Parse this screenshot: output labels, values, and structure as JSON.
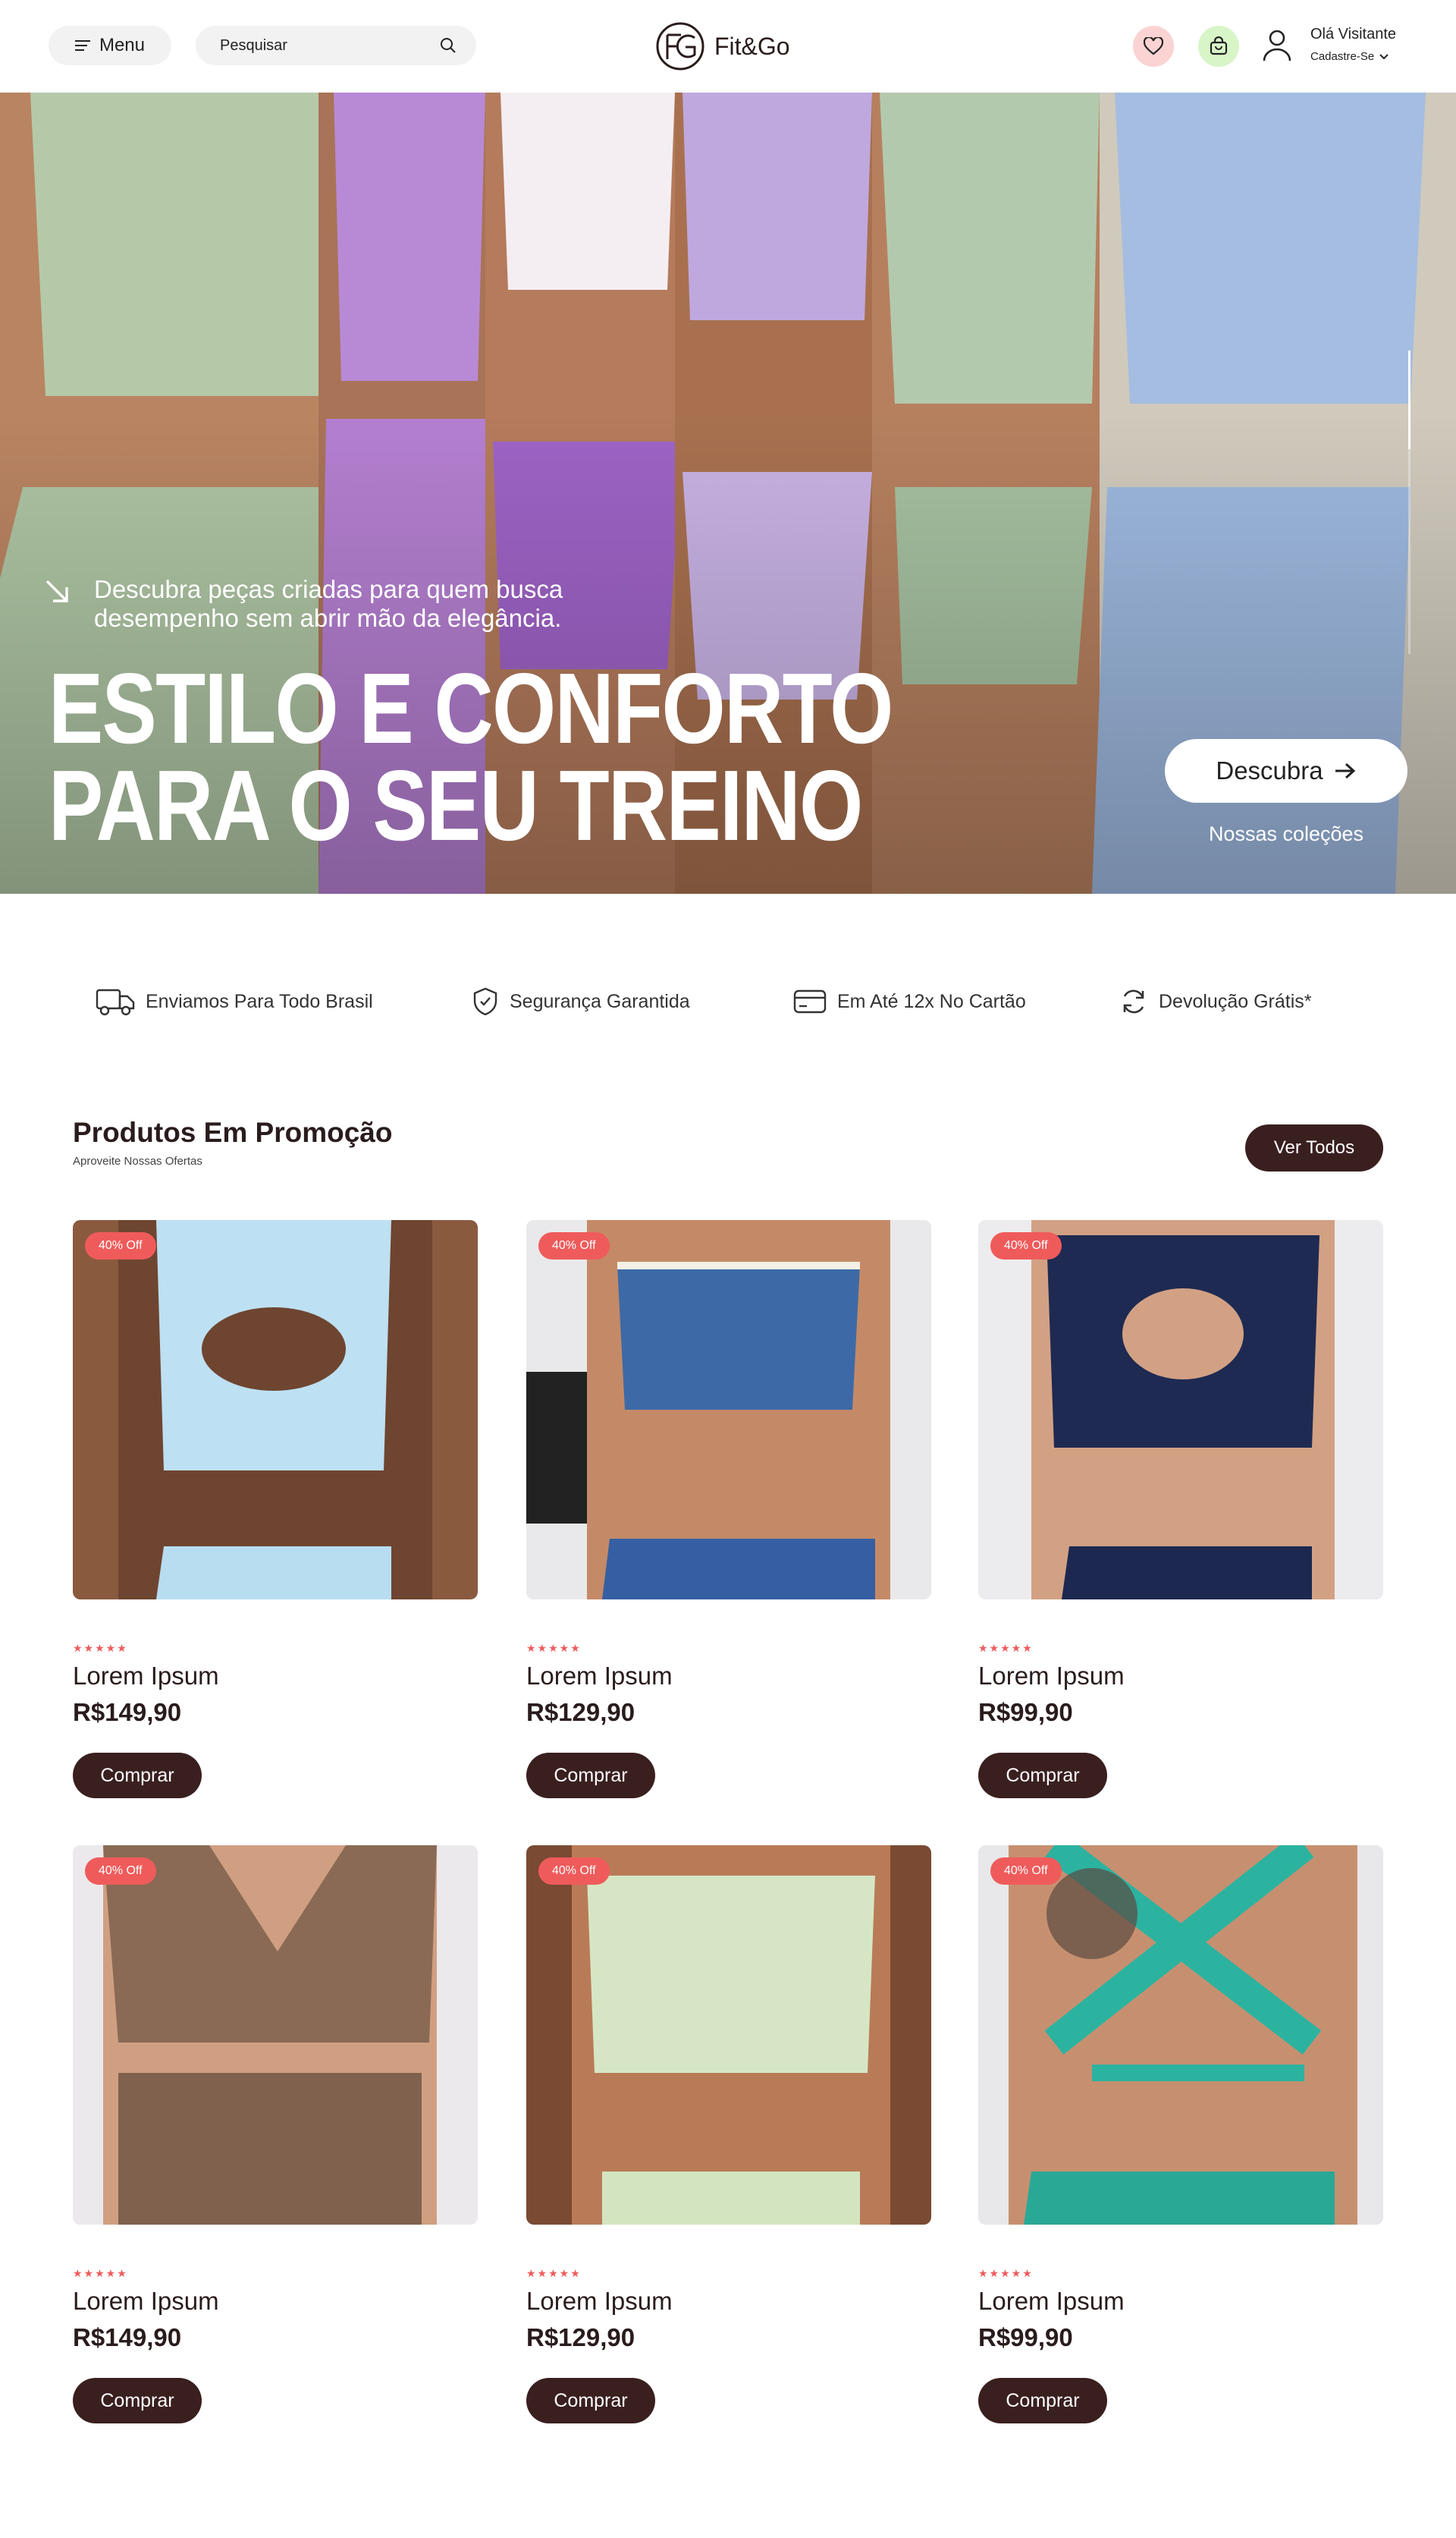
{
  "header": {
    "menu_label": "Menu",
    "search_placeholder": "Pesquisar",
    "logo_text": "Fit&Go",
    "user_greeting": "Olá Visitante",
    "user_sub": "Cadastre-Se",
    "colors": {
      "wishlist_bg": "#fbd3d3",
      "cart_bg": "#d8f5c8"
    }
  },
  "hero": {
    "subtitle": "Descubra peças criadas para quem busca desempenho sem abrir mão da elegância.",
    "title_line1": "ESTILO E CONFORTO",
    "title_line2": "PARA O SEU TREINO",
    "cta_label": "Descubra",
    "secondary_link": "Nossas coleções"
  },
  "benefits": [
    {
      "label": "Enviamos Para Todo Brasil",
      "icon": "truck-icon"
    },
    {
      "label": "Segurança Garantida",
      "icon": "shield-icon"
    },
    {
      "label": "Em Até 12x No Cartão",
      "icon": "credit-card-icon"
    },
    {
      "label": "Devolução Grátis*",
      "icon": "refresh-icon"
    }
  ],
  "products_section": {
    "title": "Produtos Em Promoção",
    "subtitle": "Aproveite Nossas Ofertas",
    "see_all": "Ver Todos"
  },
  "products": [
    {
      "badge": "40% Off",
      "stars": "★★★★★",
      "name": "Lorem Ipsum",
      "price": "R$149,90",
      "buy": "Comprar"
    },
    {
      "badge": "40% Off",
      "stars": "★★★★★",
      "name": "Lorem Ipsum",
      "price": "R$129,90",
      "buy": "Comprar"
    },
    {
      "badge": "40% Off",
      "stars": "★★★★★",
      "name": "Lorem Ipsum",
      "price": "R$99,90",
      "buy": "Comprar"
    },
    {
      "badge": "40% Off",
      "stars": "★★★★★",
      "name": "Lorem Ipsum",
      "price": "R$149,90",
      "buy": "Comprar"
    },
    {
      "badge": "40% Off",
      "stars": "★★★★★",
      "name": "Lorem Ipsum",
      "price": "R$129,90",
      "buy": "Comprar"
    },
    {
      "badge": "40% Off",
      "stars": "★★★★★",
      "name": "Lorem Ipsum",
      "price": "R$99,90",
      "buy": "Comprar"
    }
  ],
  "colors": {
    "accent_dark": "#3a1f1f",
    "badge_red": "#ef5b5b",
    "star_red": "#ef5b5b"
  }
}
